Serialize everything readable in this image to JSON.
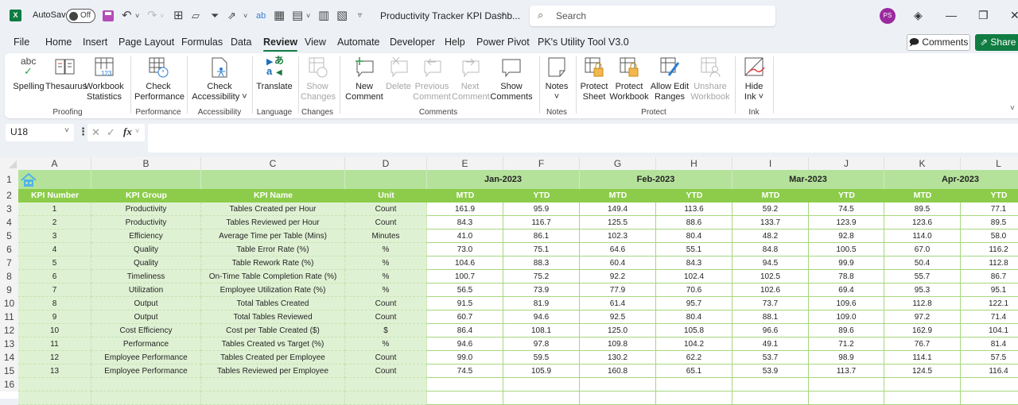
{
  "titlebar": {
    "autosave_label": "AutoSave",
    "autosave_state": "Off",
    "doc_title": "Productivity Tracker KPI Dashb...",
    "search_placeholder": "Search",
    "avatar_initials": "PS"
  },
  "menu": {
    "tabs": [
      "File",
      "Home",
      "Insert",
      "Page Layout",
      "Formulas",
      "Data",
      "Review",
      "View",
      "Automate",
      "Developer",
      "Help",
      "Power Pivot",
      "PK's Utility Tool V3.0"
    ],
    "active": "Review",
    "comments_label": "Comments",
    "share_label": "Share"
  },
  "ribbon": {
    "buttons": [
      {
        "label1": "Spelling",
        "label2": "",
        "disabled": false
      },
      {
        "label1": "Thesaurus",
        "label2": "",
        "disabled": false
      },
      {
        "label1": "Workbook",
        "label2": "Statistics",
        "disabled": false
      },
      {
        "label1": "Check",
        "label2": "Performance",
        "disabled": false
      },
      {
        "label1": "Check",
        "label2": "Accessibility ˅",
        "disabled": false
      },
      {
        "label1": "Translate",
        "label2": "",
        "disabled": false
      },
      {
        "label1": "Show",
        "label2": "Changes",
        "disabled": true
      },
      {
        "label1": "New",
        "label2": "Comment",
        "disabled": false
      },
      {
        "label1": "Delete",
        "label2": "",
        "disabled": true
      },
      {
        "label1": "Previous",
        "label2": "Comment",
        "disabled": true
      },
      {
        "label1": "Next",
        "label2": "Comment",
        "disabled": true
      },
      {
        "label1": "Show",
        "label2": "Comments",
        "disabled": false
      },
      {
        "label1": "Notes",
        "label2": "˅",
        "disabled": false
      },
      {
        "label1": "Protect",
        "label2": "Sheet",
        "disabled": false
      },
      {
        "label1": "Protect",
        "label2": "Workbook",
        "disabled": false
      },
      {
        "label1": "Allow Edit",
        "label2": "Ranges",
        "disabled": false
      },
      {
        "label1": "Unshare",
        "label2": "Workbook",
        "disabled": true
      },
      {
        "label1": "Hide",
        "label2": "Ink ˅",
        "disabled": false
      }
    ],
    "groups": [
      "Proofing",
      "Performance",
      "Accessibility",
      "Language",
      "Changes",
      "Comments",
      "Notes",
      "Protect",
      "Ink"
    ]
  },
  "formula_bar": {
    "name_box": "U18",
    "formula": ""
  },
  "sheet": {
    "columns": [
      "A",
      "B",
      "C",
      "D",
      "E",
      "F",
      "G",
      "H",
      "I",
      "J",
      "K",
      "L"
    ],
    "row_numbers": [
      "1",
      "2",
      "3",
      "4",
      "5",
      "6",
      "7",
      "8",
      "9",
      "10",
      "11",
      "12",
      "13",
      "14",
      "15",
      "16"
    ],
    "months": [
      "Jan-2023",
      "Feb-2023",
      "Mar-2023",
      "Apr-2023"
    ],
    "headers": [
      "KPI Number",
      "KPI Group",
      "KPI Name",
      "Unit"
    ],
    "sub_headers": [
      "MTD",
      "YTD"
    ],
    "rows": [
      {
        "num": "1",
        "group": "Productivity",
        "name": "Tables Created per Hour",
        "unit": "Count",
        "values": [
          "161.9",
          "95.9",
          "149.4",
          "113.6",
          "59.2",
          "74.5",
          "89.5",
          "77.1"
        ]
      },
      {
        "num": "2",
        "group": "Productivity",
        "name": "Tables Reviewed per Hour",
        "unit": "Count",
        "values": [
          "84.3",
          "116.7",
          "125.5",
          "88.6",
          "133.7",
          "123.9",
          "123.6",
          "89.5"
        ]
      },
      {
        "num": "3",
        "group": "Efficiency",
        "name": "Average Time per Table (Mins)",
        "unit": "Minutes",
        "values": [
          "41.0",
          "86.1",
          "102.3",
          "80.4",
          "48.2",
          "92.8",
          "114.0",
          "58.0"
        ]
      },
      {
        "num": "4",
        "group": "Quality",
        "name": "Table Error Rate (%)",
        "unit": "%",
        "values": [
          "73.0",
          "75.1",
          "64.6",
          "55.1",
          "84.8",
          "100.5",
          "67.0",
          "116.2"
        ]
      },
      {
        "num": "5",
        "group": "Quality",
        "name": "Table Rework Rate (%)",
        "unit": "%",
        "values": [
          "104.6",
          "88.3",
          "60.4",
          "84.3",
          "94.5",
          "99.9",
          "50.4",
          "112.8"
        ]
      },
      {
        "num": "6",
        "group": "Timeliness",
        "name": "On-Time Table Completion Rate (%)",
        "unit": "%",
        "values": [
          "100.7",
          "75.2",
          "92.2",
          "102.4",
          "102.5",
          "78.8",
          "55.7",
          "86.7"
        ]
      },
      {
        "num": "7",
        "group": "Utilization",
        "name": "Employee Utilization Rate (%)",
        "unit": "%",
        "values": [
          "56.5",
          "73.9",
          "77.9",
          "70.6",
          "102.6",
          "69.4",
          "95.3",
          "95.1"
        ]
      },
      {
        "num": "8",
        "group": "Output",
        "name": "Total Tables Created",
        "unit": "Count",
        "values": [
          "91.5",
          "81.9",
          "61.4",
          "95.7",
          "73.7",
          "109.6",
          "112.8",
          "122.1"
        ]
      },
      {
        "num": "9",
        "group": "Output",
        "name": "Total Tables Reviewed",
        "unit": "Count",
        "values": [
          "60.7",
          "94.6",
          "92.5",
          "80.4",
          "88.1",
          "109.0",
          "97.2",
          "71.4"
        ]
      },
      {
        "num": "10",
        "group": "Cost Efficiency",
        "name": "Cost per Table Created ($)",
        "unit": "$",
        "values": [
          "86.4",
          "108.1",
          "125.0",
          "105.8",
          "96.6",
          "89.6",
          "162.9",
          "104.1"
        ]
      },
      {
        "num": "11",
        "group": "Performance",
        "name": "Tables Created vs Target (%)",
        "unit": "%",
        "values": [
          "94.6",
          "97.8",
          "109.8",
          "104.2",
          "49.1",
          "71.2",
          "76.7",
          "81.4"
        ]
      },
      {
        "num": "12",
        "group": "Employee Performance",
        "name": "Tables Created per Employee",
        "unit": "Count",
        "values": [
          "99.0",
          "59.5",
          "130.2",
          "62.2",
          "53.7",
          "98.9",
          "114.1",
          "57.5"
        ]
      },
      {
        "num": "13",
        "group": "Employee Performance",
        "name": "Tables Reviewed per Employee",
        "unit": "Count",
        "values": [
          "74.5",
          "105.9",
          "160.8",
          "65.1",
          "53.9",
          "113.7",
          "124.5",
          "116.4"
        ]
      }
    ]
  },
  "colors": {
    "accent": "#107c41",
    "header_light": "#b4e29a",
    "header_dark": "#8ccc4a",
    "info_fill": "#dff1d3"
  }
}
